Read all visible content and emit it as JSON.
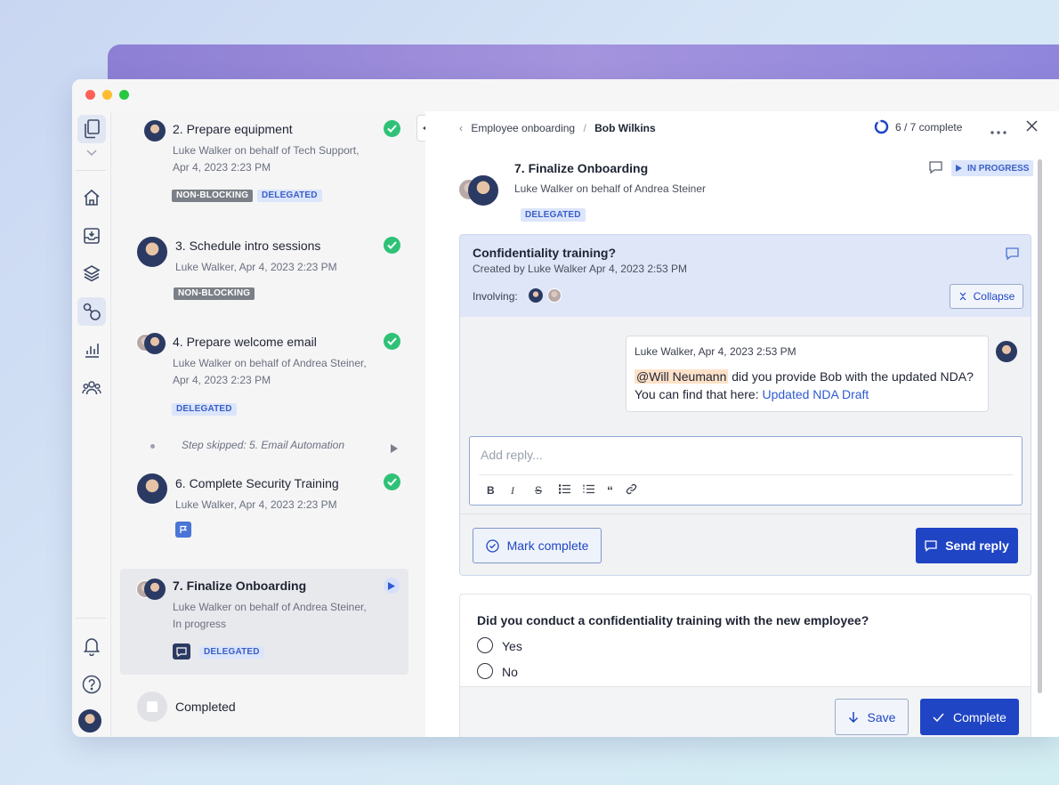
{
  "rail": {
    "items": [
      "documents",
      "home",
      "inbox",
      "layers",
      "workflows",
      "reports",
      "people"
    ],
    "bottom": [
      "notifications",
      "help",
      "profile"
    ]
  },
  "steps": [
    {
      "title": "2. Prepare equipment",
      "sub": "Luke Walker on behalf of Tech Support, Apr 4, 2023 2:23 PM",
      "tags": [
        "NON-BLOCKING",
        "DELEGATED"
      ],
      "status": "complete"
    },
    {
      "title": "3. Schedule intro sessions",
      "sub": "Luke Walker, Apr 4, 2023 2:23 PM",
      "tags": [
        "NON-BLOCKING"
      ],
      "status": "complete"
    },
    {
      "title": "4. Prepare welcome email",
      "sub": "Luke Walker on behalf of Andrea Steiner, Apr 4, 2023 2:23 PM",
      "tags": [
        "DELEGATED"
      ],
      "status": "complete"
    },
    {
      "title": "Step skipped: 5. Email Automation",
      "status": "skipped"
    },
    {
      "title": "6. Complete Security Training",
      "sub": "Luke Walker, Apr 4, 2023 2:23 PM",
      "status": "complete"
    },
    {
      "title": "7. Finalize Onboarding",
      "sub": "Luke Walker on behalf of Andrea Steiner, In progress",
      "tags": [
        "DELEGATED"
      ],
      "status": "in-progress"
    },
    {
      "title": "Completed",
      "status": "end"
    }
  ],
  "header": {
    "breadcrumb_parent": "Employee onboarding",
    "breadcrumb_separator": "/",
    "breadcrumb_current": "Bob Wilkins",
    "progress_label": "6 / 7 complete",
    "progress_fraction": 0.857
  },
  "task": {
    "title": "7. Finalize Onboarding",
    "meta": "Luke Walker on behalf of Andrea Steiner",
    "tag": "DELEGATED",
    "status": "IN PROGRESS"
  },
  "thread": {
    "title": "Confidentiality training?",
    "created": "Created by Luke Walker Apr 4, 2023 2:53 PM",
    "involving_label": "Involving:",
    "collapse_label": "Collapse",
    "comment_meta": "Luke Walker, Apr 4, 2023 2:53 PM",
    "mention": "@Will Neumann",
    "comment_text_1": " did you provide Bob with the updated NDA?",
    "comment_text_2": "You can find that here: ",
    "comment_link": "Updated NDA Draft",
    "reply_placeholder": "Add reply...",
    "mark_complete_label": "Mark complete",
    "send_reply_label": "Send reply"
  },
  "question": {
    "text": "Did you conduct a confidentiality training with the new employee?",
    "options": [
      "Yes",
      "No"
    ],
    "save_label": "Save",
    "complete_label": "Complete"
  },
  "colors": {
    "primary": "#1f45c4",
    "success": "#2fc277",
    "delegated_bg": "#dbe5fb",
    "nonblocking_bg": "#7b7f87"
  }
}
